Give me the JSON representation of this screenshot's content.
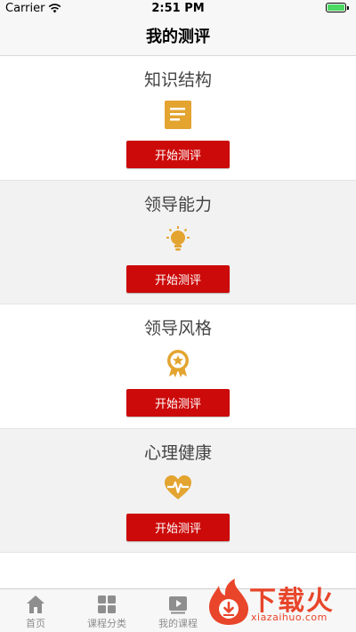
{
  "status_bar": {
    "carrier": "Carrier",
    "time": "2:51 PM",
    "battery_level": 1.0
  },
  "nav": {
    "title": "我的测评"
  },
  "sections": [
    {
      "title": "知识结构",
      "button_label": "开始测评",
      "icon": "document-icon"
    },
    {
      "title": "领导能力",
      "button_label": "开始测评",
      "icon": "lightbulb-icon"
    },
    {
      "title": "领导风格",
      "button_label": "开始测评",
      "icon": "award-icon"
    },
    {
      "title": "心理健康",
      "button_label": "开始测评",
      "icon": "heartbeat-icon"
    }
  ],
  "tabs": [
    {
      "label": "首页",
      "icon": "home-icon"
    },
    {
      "label": "课程分类",
      "icon": "grid-icon"
    },
    {
      "label": "我的课程",
      "icon": "play-icon"
    }
  ],
  "watermark": {
    "brand": "下载火",
    "url": "xiazaihuo.com"
  },
  "colors": {
    "accent_red": "#cc0a0a",
    "icon_gold": "#e3a430",
    "tab_gray": "#8e8e8e",
    "battery_green": "#4cd964",
    "watermark_orange": "#e8452a"
  }
}
